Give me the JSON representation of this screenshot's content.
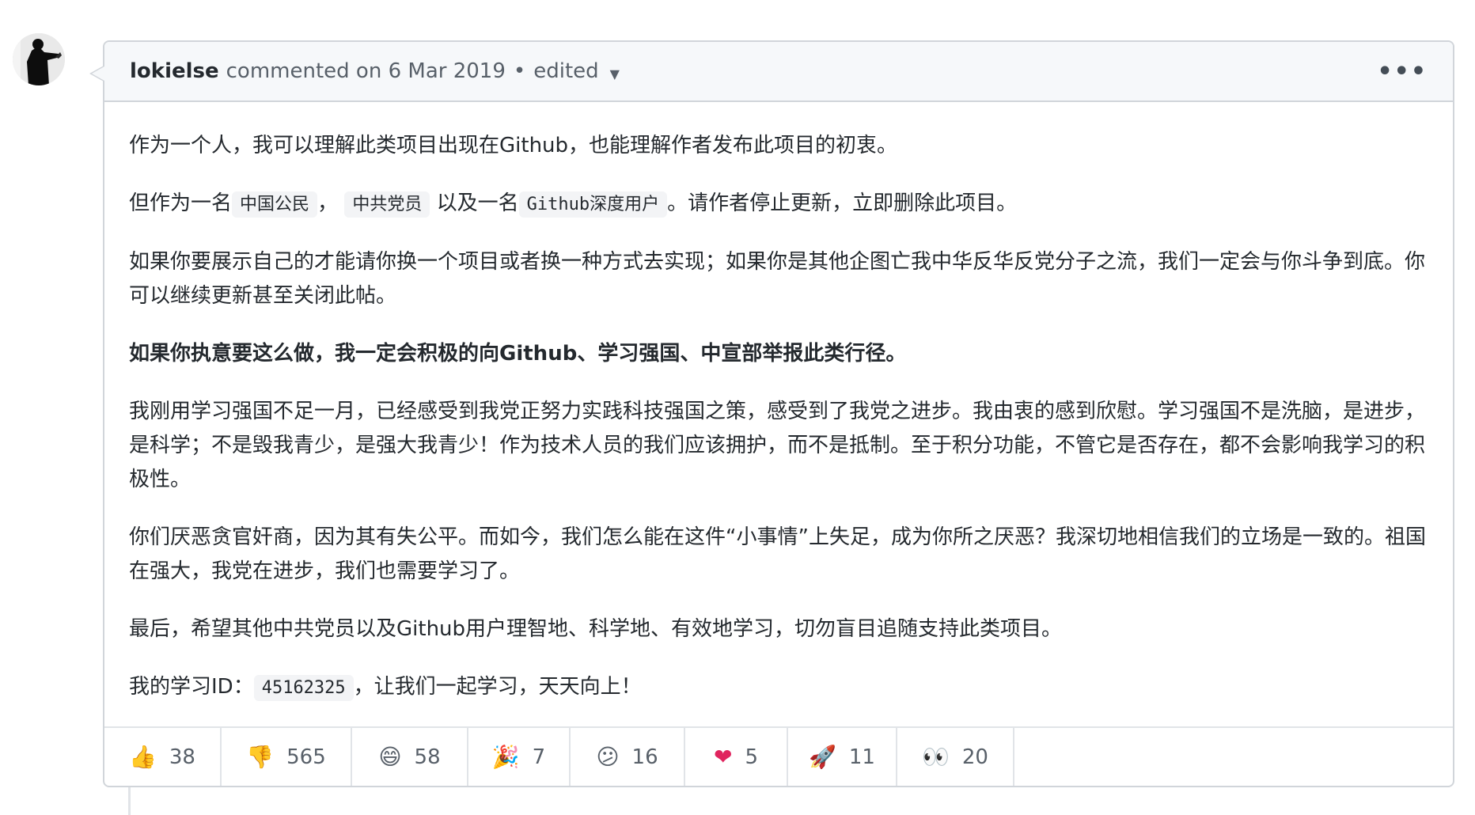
{
  "comment": {
    "author": "lokielse",
    "action_text": "commented on 6 Mar 2019",
    "separator": "•",
    "edited_label": "edited",
    "menu_glyph": "•••",
    "paragraphs": {
      "p1": "作为一个人，我可以理解此类项目出现在Github，也能理解作者发布此项目的初衷。",
      "p2": {
        "t1": "但作为一名",
        "c1": "中国公民",
        "t2": "，",
        "c2": "中共党员",
        "t3": "以及一名",
        "c3": "Github深度用户",
        "t4": "。请作者停止更新，立即删除此项目。"
      },
      "p3": "如果你要展示自己的才能请你换一个项目或者换一种方式去实现；如果你是其他企图亡我中华反华反党分子之流，我们一定会与你斗争到底。你可以继续更新甚至关闭此帖。",
      "p4": "如果你执意要这么做，我一定会积极的向Github、学习强国、中宣部举报此类行径。",
      "p5": "我刚用学习强国不足一月，已经感受到我党正努力实践科技强国之策，感受到了我党之进步。我由衷的感到欣慰。学习强国不是洗脑，是进步，是科学；不是毁我青少，是强大我青少！作为技术人员的我们应该拥护，而不是抵制。至于积分功能，不管它是否存在，都不会影响我学习的积极性。",
      "p6": "你们厌恶贪官奸商，因为其有失公平。而如今，我们怎么能在这件“小事情”上失足，成为你所之厌恶？我深切地相信我们的立场是一致的。祖国在强大，我党在进步，我们也需要学习了。",
      "p7": "最后，希望其他中共党员以及Github用户理智地、科学地、有效地学习，切勿盲目追随支持此类项目。",
      "p8": {
        "t1": "我的学习ID：",
        "c1": "45162325",
        "t2": "，让我们一起学习，天天向上！"
      }
    },
    "reactions": [
      {
        "icon": "thumbs-up-icon",
        "emoji": "👍",
        "count": "38"
      },
      {
        "icon": "thumbs-down-icon",
        "emoji": "👎",
        "count": "565"
      },
      {
        "icon": "laugh-icon",
        "emoji": "😄",
        "count": "58"
      },
      {
        "icon": "hooray-icon",
        "emoji": "🎉",
        "count": "7"
      },
      {
        "icon": "confused-icon",
        "emoji": "😕",
        "count": "16"
      },
      {
        "icon": "heart-icon",
        "emoji": "❤",
        "count": "5"
      },
      {
        "icon": "rocket-icon",
        "emoji": "🚀",
        "count": "11"
      },
      {
        "icon": "eyes-icon",
        "emoji": "👀",
        "count": "20"
      }
    ]
  },
  "colors": {
    "border": "#d1d5da",
    "header_bg": "#f6f8fa",
    "text": "#24292e",
    "muted": "#586069",
    "heart": "#e0245e"
  }
}
